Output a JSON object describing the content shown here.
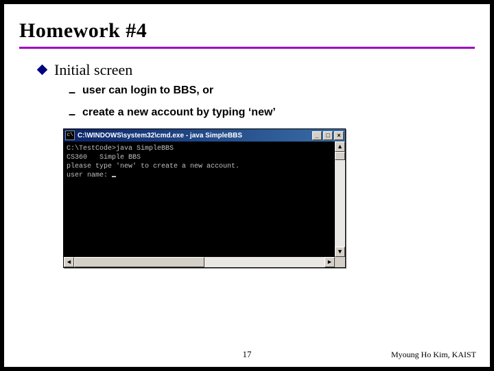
{
  "title": "Homework #4",
  "bullet": "Initial screen",
  "sub1": "user can login to BBS, or",
  "sub2": "create a new account by typing ‘new’",
  "console": {
    "icon_glyph": "c\\",
    "title": "C:\\WINDOWS\\system32\\cmd.exe - java SimpleBBS",
    "lines": [
      "C:\\TestCode>java SimpleBBS",
      "CS360   Simple BBS",
      "please type 'new' to create a new account.",
      "user name: "
    ],
    "min_glyph": "_",
    "max_glyph": "□",
    "close_glyph": "×",
    "arrow_left": "◄",
    "arrow_right": "►",
    "arrow_up": "▲",
    "arrow_down": "▼"
  },
  "page_number": "17",
  "footer_right": "Myoung Ho Kim, KAIST"
}
